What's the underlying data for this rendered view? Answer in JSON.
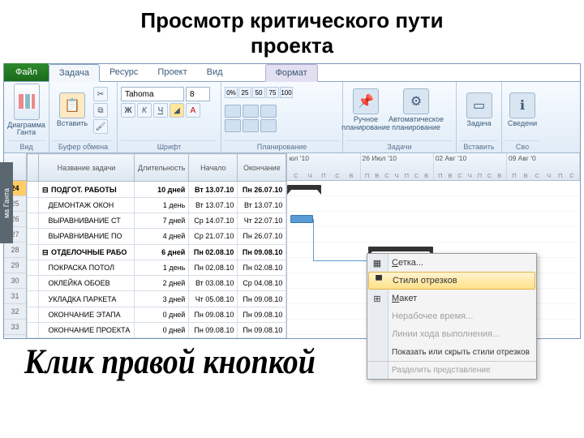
{
  "page_title_l1": "Просмотр критического пути",
  "page_title_l2": "проекта",
  "caption": "Клик правой кнопкой",
  "side_label": "ма Ганта",
  "tabs": {
    "file": "Файл",
    "task": "Задача",
    "resource": "Ресурс",
    "project": "Проект",
    "view": "Вид",
    "format": "Формат"
  },
  "ribbon": {
    "view": {
      "label": "Вид",
      "gantt": "Диаграмма Ганта"
    },
    "clipboard": {
      "label": "Буфер обмена",
      "paste": "Вставить"
    },
    "font": {
      "label": "Шрифт",
      "name": "Tahoma",
      "size": "8",
      "bold": "Ж",
      "italic": "К",
      "underline": "Ч"
    },
    "planning": {
      "label": "Планирование"
    },
    "tasks": {
      "label": "Задачи",
      "manual": "Ручное планирование",
      "auto": "Автоматическое планирование"
    },
    "insert": {
      "label": "Вставить",
      "task": "Задача"
    },
    "props": {
      "label": "Сво",
      "info": "Сведени"
    }
  },
  "columns": {
    "id": "",
    "name": "Название задачи",
    "dur": "Длительность",
    "start": "Начало",
    "finish": "Окончание"
  },
  "timeline": {
    "w1": "юл '10",
    "w2": "26 Июл '10",
    "w3": "02 Авг '10",
    "w4": "09 Авг '0",
    "dayset": "С Ч П С В П В С Ч П С В П В С Ч П С В П В С Ч П С"
  },
  "rows": [
    {
      "id": "24",
      "name": "ПОДГОТ. РАБОТЫ",
      "dur": "10 дней",
      "start": "Вт 13.07.10",
      "finish": "Пн 26.07.10",
      "sum": true
    },
    {
      "id": "25",
      "name": "ДЕМОНТАЖ ОКОН",
      "dur": "1 день",
      "start": "Вт 13.07.10",
      "finish": "Вт 13.07.10"
    },
    {
      "id": "26",
      "name": "ВЫРАВНИВАНИЕ СТ",
      "dur": "7 дней",
      "start": "Ср 14.07.10",
      "finish": "Чт 22.07.10"
    },
    {
      "id": "27",
      "name": "ВЫРАВНИВАНИЕ ПО",
      "dur": "4 дней",
      "start": "Ср 21.07.10",
      "finish": "Пн 26.07.10"
    },
    {
      "id": "28",
      "name": "ОТДЕЛОЧНЫЕ РАБО",
      "dur": "6 дней",
      "start": "Пн 02.08.10",
      "finish": "Пн 09.08.10",
      "sum": true
    },
    {
      "id": "29",
      "name": "ПОКРАСКА ПОТОЛ",
      "dur": "1 день",
      "start": "Пн 02.08.10",
      "finish": "Пн 02.08.10"
    },
    {
      "id": "30",
      "name": "ОКЛЕЙКА ОБОЕВ",
      "dur": "2 дней",
      "start": "Вт 03.08.10",
      "finish": "Ср 04.08.10"
    },
    {
      "id": "31",
      "name": "УКЛАДКА ПАРКЕТА",
      "dur": "3 дней",
      "start": "Чт 05.08.10",
      "finish": "Пн 09.08.10"
    },
    {
      "id": "32",
      "name": "ОКОНЧАНИЕ ЭТАПА",
      "dur": "0 дней",
      "start": "Пн 09.08.10",
      "finish": "Пн 09.08.10"
    },
    {
      "id": "33",
      "name": "ОКОНЧАНИЕ ПРОЕКТА",
      "dur": "0 дней",
      "start": "Пн 09.08.10",
      "finish": "Пн 09.08.10"
    }
  ],
  "ctx": {
    "grid": "Сетка...",
    "barstyles": "Стили отрезков",
    "layout": "Макет",
    "nonwork": "Нерабочее время...",
    "progress": "Линии хода выполнения...",
    "showhide": "Показать или скрыть стили отрезков",
    "split": "Разделить представление"
  }
}
